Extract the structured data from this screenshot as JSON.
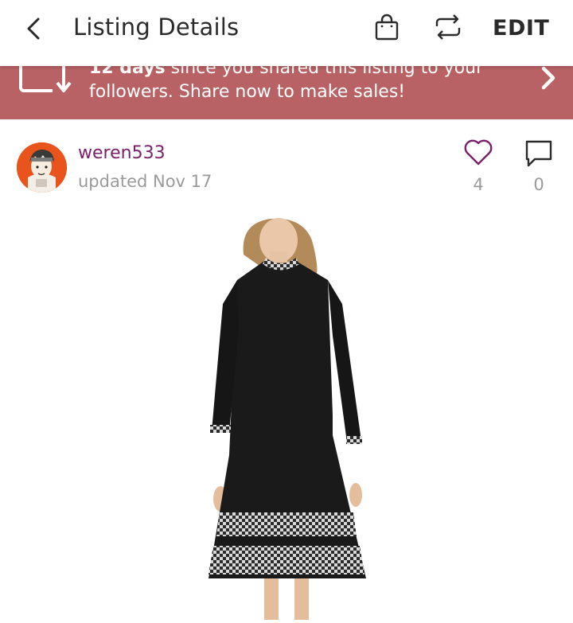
{
  "header": {
    "title": "Listing Details",
    "edit_label": "EDIT",
    "icons": [
      "back-arrow-icon",
      "shopping-bag-icon",
      "share-icon"
    ]
  },
  "banner": {
    "line1_bold": "12 days",
    "line1_rest": " since you shared this listing to your",
    "line2": "followers. Share now to make sales!",
    "background_color": "#b96265",
    "icons": [
      "share-arrows-icon",
      "chevron-right-icon"
    ]
  },
  "seller": {
    "username": "weren533",
    "updated": "updated Nov 17",
    "username_color": "#7b1f6a"
  },
  "stats": {
    "likes": "4",
    "comments": "0",
    "like_icon_color": "#7b1f6a"
  },
  "product": {
    "image_icon": "dress-photo"
  }
}
